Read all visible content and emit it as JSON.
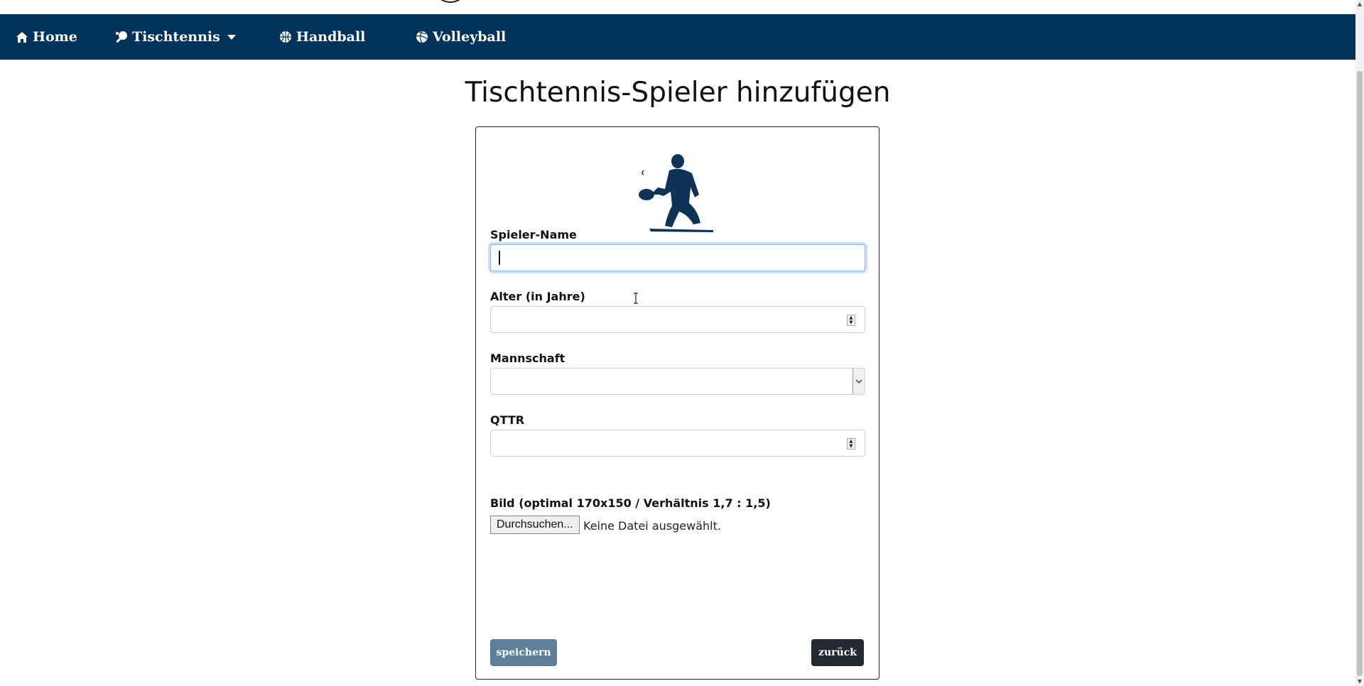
{
  "nav": {
    "home_label": "Home",
    "tischtennis_label": "Tischtennis",
    "handball_label": "Handball",
    "volleyball_label": "Volleyball",
    "icons": [
      "home-icon",
      "table-tennis-icon",
      "handball-icon",
      "volleyball-icon"
    ]
  },
  "page": {
    "title": "Tischtennis-Spieler hinzufügen"
  },
  "form": {
    "name_label": "Spieler-Name",
    "name_value": "",
    "age_label": "Alter (in Jahre)",
    "age_value": "",
    "team_label": "Mannschaft",
    "team_value": "",
    "qttr_label": "QTTR",
    "qttr_value": "",
    "image_label": "Bild (optimal 170x150 / Verhältnis 1,7 : 1,5)",
    "file_button_label": "Durchsuchen...",
    "file_status": "Keine Datei ausgewählt.",
    "save_label": "speichern",
    "back_label": "zurück"
  },
  "colors": {
    "navbar": "#00325a",
    "save_button": "#5f7f99",
    "back_button": "#23292f",
    "focus_ring": "#86b7fe"
  }
}
